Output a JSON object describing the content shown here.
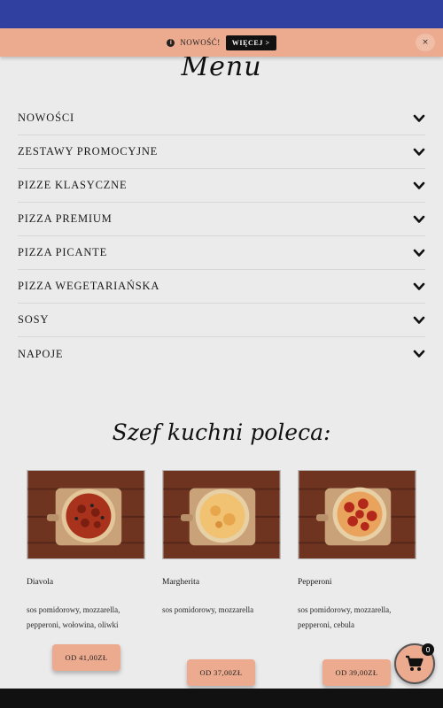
{
  "notice": {
    "icon": "info-icon",
    "text": "NOWOŚĆ!",
    "more_label": "WIĘCEJ >",
    "close_label": "×"
  },
  "menu": {
    "title": "Menu",
    "categories": [
      {
        "label": "NOWOŚCI"
      },
      {
        "label": "ZESTAWY PROMOCYJNE"
      },
      {
        "label": "PIZZE KLASYCZNE"
      },
      {
        "label": "PIZZA PREMIUM"
      },
      {
        "label": "PIZZA PICANTE"
      },
      {
        "label": "PIZZA WEGETARIAŃSKA"
      },
      {
        "label": "SOSY"
      },
      {
        "label": "NAPOJE"
      }
    ]
  },
  "recommended": {
    "title": "Szef kuchni poleca:",
    "items": [
      {
        "name": "Diavola",
        "description": "sos pomidorowy, mozzarella, pepperoni, wołowina, oliwki",
        "price_label": "OD 41,00ZŁ",
        "topping": "diavola"
      },
      {
        "name": "Margherita",
        "description": "sos pomidorowy, mozzarella",
        "price_label": "OD 37,00ZŁ",
        "topping": "margherita"
      },
      {
        "name": "Pepperoni",
        "description": "sos pomidorowy, mozzarella, pepperoni, cebula",
        "price_label": "OD 39,00ZŁ",
        "topping": "pepperoni"
      }
    ]
  },
  "cart": {
    "icon": "cart-icon",
    "count": "0"
  },
  "colors": {
    "topbar": "#3040a0",
    "accent": "#ecab8f",
    "background": "#ebebeb"
  }
}
